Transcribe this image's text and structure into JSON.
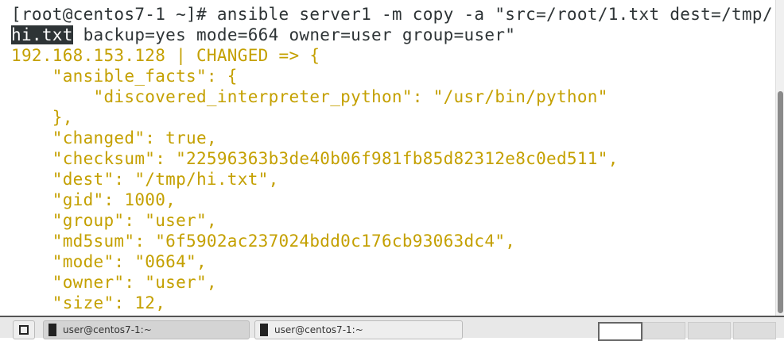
{
  "terminal": {
    "partial_top": "  ...",
    "command_prompt": "[root@centos7-1 ~]# ansible server1 -m copy -a \"src=/root/1.txt dest=/tmp/",
    "command_selected": "hi.txt",
    "command_rest": " backup=yes mode=664 owner=user group=user\"",
    "output": [
      "192.168.153.128 | CHANGED => {",
      "    \"ansible_facts\": {",
      "        \"discovered_interpreter_python\": \"/usr/bin/python\"",
      "    },",
      "    \"changed\": true,",
      "    \"checksum\": \"22596363b3de40b06f981fb85d82312e8c0ed511\",",
      "    \"dest\": \"/tmp/hi.txt\",",
      "    \"gid\": 1000,",
      "    \"group\": \"user\",",
      "    \"md5sum\": \"6f5902ac237024bdd0c176cb93063dc4\",",
      "    \"mode\": \"0664\",",
      "    \"owner\": \"user\",",
      "    \"size\": 12,"
    ]
  },
  "taskbar": {
    "windows": [
      {
        "label": "user@centos7-1:~"
      },
      {
        "label": "user@centos7-1:~"
      }
    ]
  }
}
